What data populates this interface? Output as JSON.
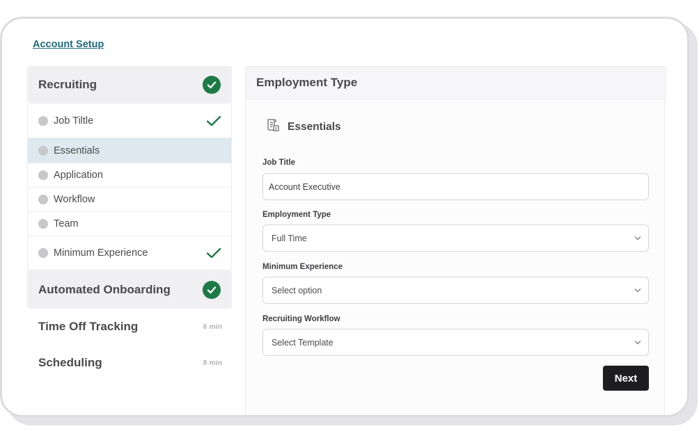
{
  "breadcrumb": {
    "label": "Account Setup"
  },
  "sidebar": {
    "recruiting": {
      "title": "Recruiting",
      "items": [
        {
          "label": "Job Tiltle",
          "completed": true,
          "active": false
        },
        {
          "label": "Essentials",
          "completed": false,
          "active": true
        },
        {
          "label": "Application",
          "completed": false,
          "active": false
        },
        {
          "label": "Workflow",
          "completed": false,
          "active": false
        },
        {
          "label": "Team",
          "completed": false,
          "active": false
        },
        {
          "label": "Minimum Experience",
          "completed": true,
          "active": false
        }
      ]
    },
    "onboarding": {
      "title": "Automated Onboarding"
    },
    "time_off": {
      "title": "Time Off Tracking",
      "duration": "6 min"
    },
    "scheduling": {
      "title": "Scheduling",
      "duration": "8 min"
    }
  },
  "main": {
    "header_title": "Employment Type",
    "section_title": "Essentials",
    "section_icon": "document-stack-icon",
    "fields": {
      "job_title": {
        "label": "Job Title",
        "value": "Account Executive"
      },
      "employment_type": {
        "label": "Employment Type",
        "value": "Full Time"
      },
      "minimum_experience": {
        "label": "Minimum Experience",
        "value": "Select option"
      },
      "recruiting_workflow": {
        "label": "Recruiting Workflow",
        "value": "Select Template"
      }
    },
    "next_label": "Next"
  },
  "colors": {
    "accent_link": "#1e6b7a",
    "success_green": "#1d7a46",
    "active_item_bg": "#dde9ee",
    "button_dark": "#1d1d1f"
  }
}
